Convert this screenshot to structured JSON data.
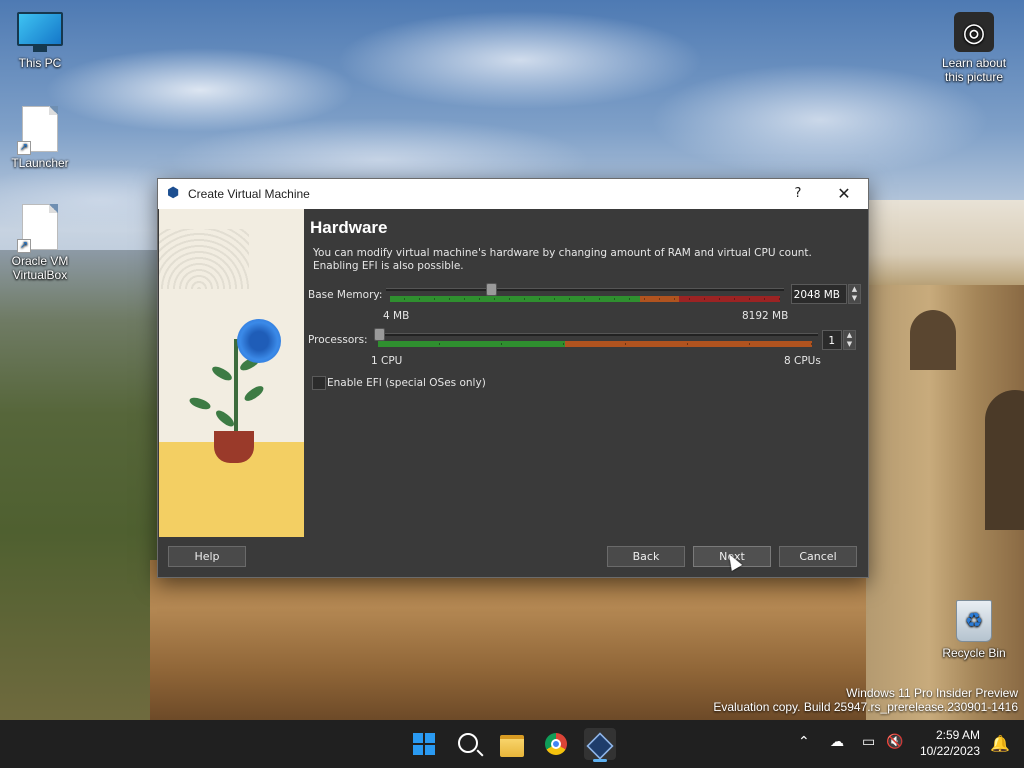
{
  "desktop": {
    "icons": [
      {
        "label": "This PC"
      },
      {
        "label": "TLauncher"
      },
      {
        "label": "Oracle VM VirtualBox"
      },
      {
        "label": "Learn about this picture"
      },
      {
        "label": "Recycle Bin"
      }
    ],
    "watermark": {
      "line1": "Windows 11 Pro Insider Preview",
      "line2": "Evaluation copy. Build 25947.rs_prerelease.230901-1416"
    }
  },
  "dialog": {
    "title": "Create Virtual Machine",
    "help_glyph": "?",
    "close_glyph": "✕",
    "heading": "Hardware",
    "description": [
      "You can modify virtual machine's hardware by changing amount of RAM and virtual CPU count.",
      "Enabling EFI is also possible."
    ],
    "memory": {
      "label": "Base Memory:",
      "value": "2048 MB",
      "min_label": "4 MB",
      "max_label": "8192 MB",
      "fraction": 0.25,
      "colors": {
        "ok": "#2f8f2f",
        "warn": "#b0531f",
        "bad": "#9c2323"
      }
    },
    "processors": {
      "label": "Processors:",
      "value": "1",
      "min_label": "1 CPU",
      "max_label": "8 CPUs",
      "fraction": 0.0
    },
    "efi": {
      "label": "Enable EFI (special OSes only)",
      "checked": false
    },
    "buttons": {
      "help": "Help",
      "back": "Back",
      "next": "Next",
      "cancel": "Cancel"
    }
  },
  "taskbar": {
    "apps": [
      {
        "icon": "windows-start-icon"
      },
      {
        "icon": "search-icon"
      },
      {
        "icon": "file-explorer-icon"
      },
      {
        "icon": "chrome-icon"
      },
      {
        "icon": "virtualbox-icon",
        "active": true
      }
    ],
    "time": "2:59 AM",
    "date": "10/22/2023"
  }
}
